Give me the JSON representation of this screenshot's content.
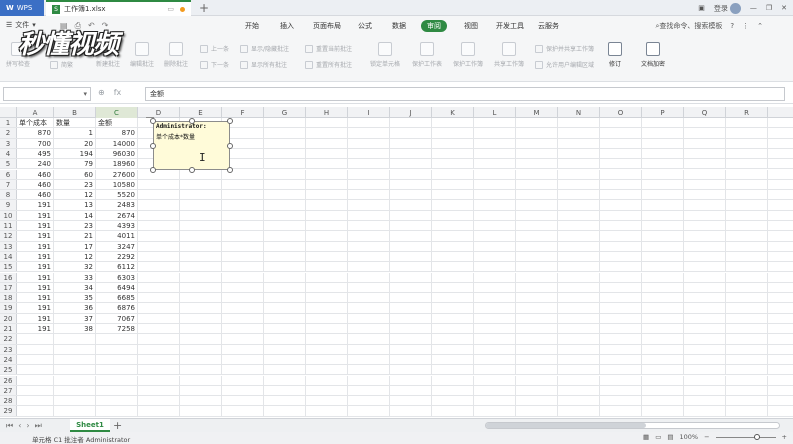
{
  "titlebar": {
    "app_label": "WPS",
    "file_tab": "工作簿1.xlsx",
    "login": "登录"
  },
  "menubar": {
    "file": "文件",
    "items": [
      "开始",
      "插入",
      "页面布局",
      "公式",
      "数据",
      "审阅",
      "视图",
      "开发工具",
      "云服务"
    ],
    "search": "查找命令、搜索模板",
    "help": "?"
  },
  "ribbon": {
    "spell": "拼写检查",
    "cn": "简繁",
    "new_comment": "新建批注",
    "edit_comment": "编辑批注",
    "delete_comment": "删除批注",
    "prev": "上一条",
    "next": "下一条",
    "show_hide_comment": "显示/隐藏批注",
    "show_all_comments": "显示所有批注",
    "reset_current": "重置当前批注",
    "reset_all": "重置所有批注",
    "lock_cell": "锁定单元格",
    "protect_sheet": "保护工作表",
    "protect_book": "保护工作簿",
    "share_book": "共享工作簿",
    "protect_share": "保护并共享工作簿",
    "allow_edit": "允许用户编辑区域",
    "track": "修订",
    "encrypt": "文档加密"
  },
  "watermark": "秒懂视频",
  "formula": {
    "fx": "fx",
    "content": "金额"
  },
  "columns": [
    "A",
    "B",
    "C",
    "D",
    "E",
    "F",
    "G",
    "H",
    "I",
    "J",
    "K",
    "L",
    "M",
    "N",
    "O",
    "P",
    "Q",
    "R"
  ],
  "sheet": {
    "rows": [
      [
        "单个成本",
        "数量",
        "金额"
      ],
      [
        "870",
        "1",
        "870"
      ],
      [
        "700",
        "20",
        "14000"
      ],
      [
        "495",
        "194",
        "96030"
      ],
      [
        "240",
        "79",
        "18960"
      ],
      [
        "460",
        "60",
        "27600"
      ],
      [
        "460",
        "23",
        "10580"
      ],
      [
        "460",
        "12",
        "5520"
      ],
      [
        "191",
        "13",
        "2483"
      ],
      [
        "191",
        "14",
        "2674"
      ],
      [
        "191",
        "23",
        "4393"
      ],
      [
        "191",
        "21",
        "4011"
      ],
      [
        "191",
        "17",
        "3247"
      ],
      [
        "191",
        "12",
        "2292"
      ],
      [
        "191",
        "32",
        "6112"
      ],
      [
        "191",
        "33",
        "6303"
      ],
      [
        "191",
        "34",
        "6494"
      ],
      [
        "191",
        "35",
        "6685"
      ],
      [
        "191",
        "36",
        "6876"
      ],
      [
        "191",
        "37",
        "7067"
      ],
      [
        "191",
        "38",
        "7258"
      ]
    ],
    "total_rows": 29
  },
  "comment": {
    "author": "Administrator:",
    "text": "单个成本*数量"
  },
  "sheet_tab": "Sheet1",
  "status": {
    "text": "单元格 C1 批注者 Administrator",
    "zoom": "100%"
  }
}
